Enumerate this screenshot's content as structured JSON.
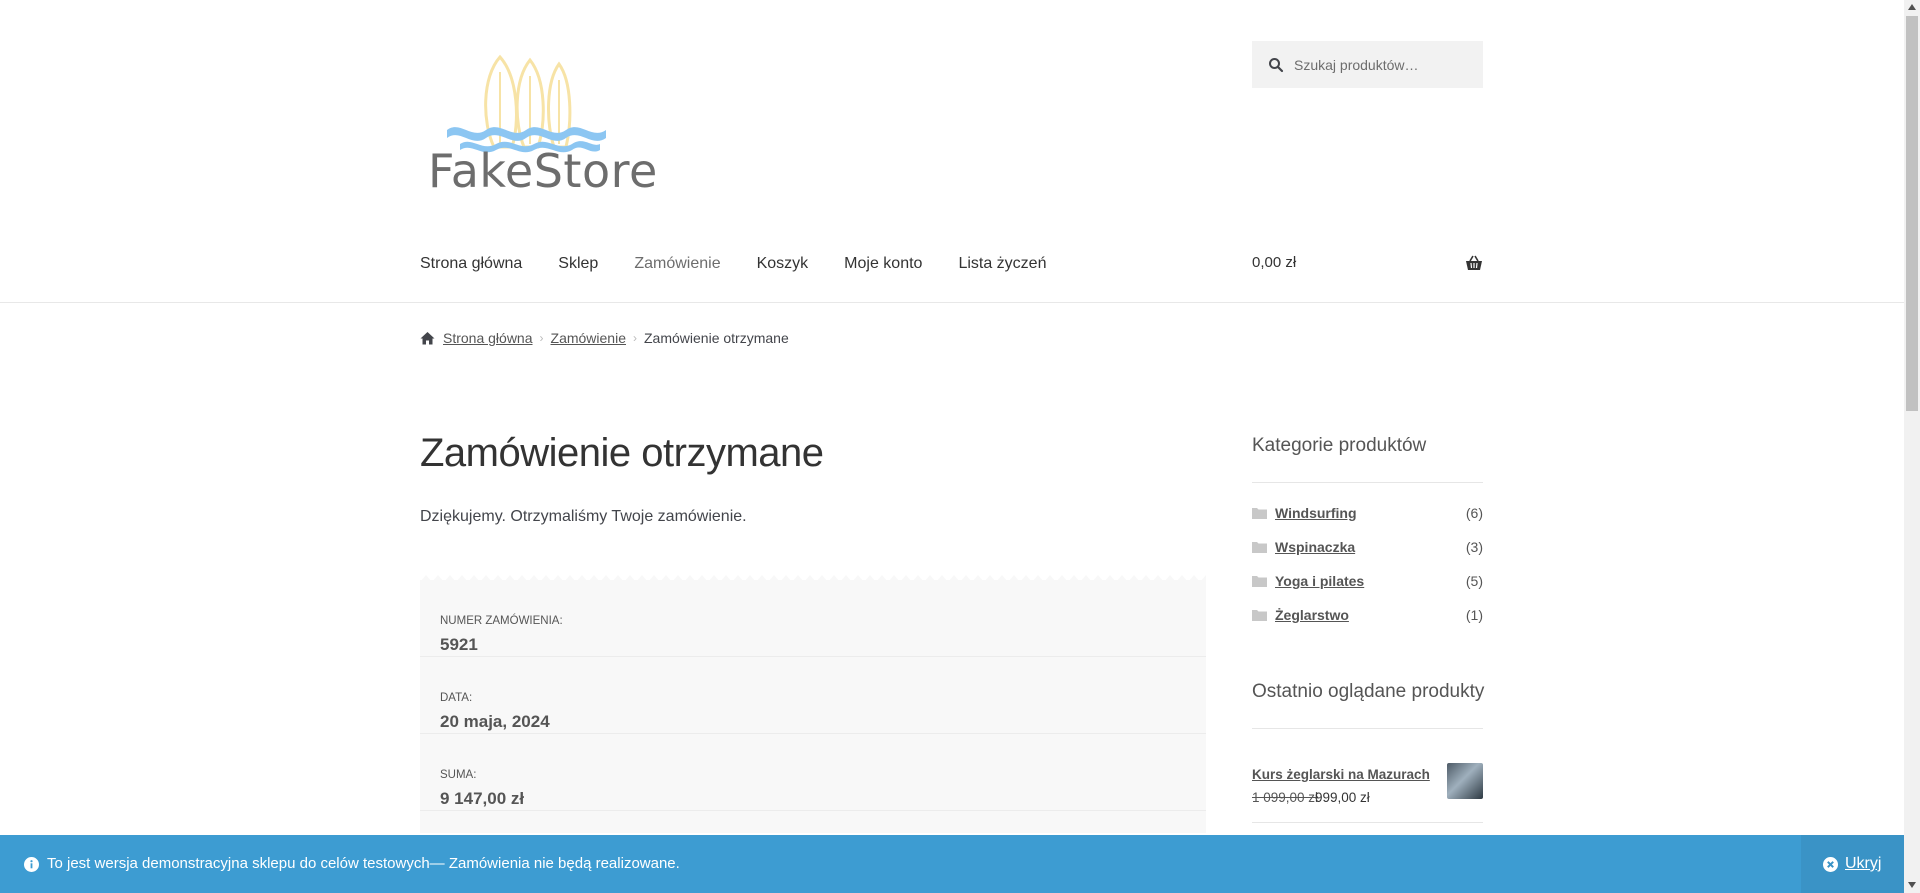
{
  "header": {
    "logo_text": "FakeStore",
    "search_placeholder": "Szukaj produktów…",
    "nav": [
      {
        "label": "Strona główna"
      },
      {
        "label": "Sklep"
      },
      {
        "label": "Zamówienie"
      },
      {
        "label": "Koszyk"
      },
      {
        "label": "Moje konto"
      },
      {
        "label": "Lista życzeń"
      }
    ],
    "cart_total": "0,00 zł"
  },
  "breadcrumb": {
    "home": "Strona główna",
    "parent": "Zamówienie",
    "current": "Zamówienie otrzymane"
  },
  "main": {
    "title": "Zamówienie otrzymane",
    "thanks": "Dziękujemy. Otrzymaliśmy Twoje zamówienie.",
    "overview": [
      {
        "label": "Numer zamówienia:",
        "value": "5921"
      },
      {
        "label": "Data:",
        "value": "20 maja, 2024"
      },
      {
        "label": "Suma:",
        "value": "9 147,00 zł"
      }
    ]
  },
  "sidebar": {
    "categories_title": "Kategorie produktów",
    "categories": [
      {
        "name": "Windsurfing",
        "count": "(6)"
      },
      {
        "name": "Wspinaczka",
        "count": "(3)"
      },
      {
        "name": "Yoga i pilates",
        "count": "(5)"
      },
      {
        "name": "Żeglarstwo",
        "count": "(1)"
      }
    ],
    "recent_title": "Ostatnio oglądane produkty",
    "recent": [
      {
        "name": "Kurs żeglarski na Mazurach",
        "old_price": "1 099,00 zł",
        "new_price": "999,00 zł"
      }
    ]
  },
  "notice": {
    "message": "To jest wersja demonstracyjna sklepu do celów testowych— Zamówienia nie będą realizowane.",
    "dismiss": "Ukryj"
  },
  "colors": {
    "notice_bg": "#3d9cd2",
    "logo_wave": "#8cc6f2",
    "logo_boards": "#f7e3a6"
  }
}
